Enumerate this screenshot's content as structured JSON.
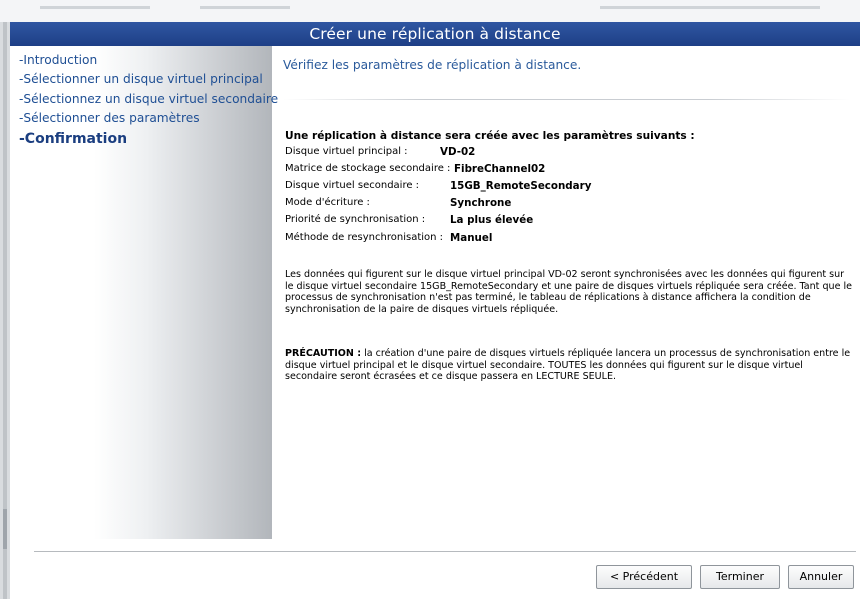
{
  "window": {
    "title": "Créer une réplication à distance"
  },
  "sidebar": {
    "items": [
      {
        "label": "-Introduction",
        "active": false
      },
      {
        "label": "-Sélectionner un disque virtuel principal",
        "active": false
      },
      {
        "label": "-Sélectionnez un disque virtuel secondaire",
        "active": false
      },
      {
        "label": "-Sélectionner des paramètres",
        "active": false
      },
      {
        "label": "-Confirmation",
        "active": true
      }
    ]
  },
  "content": {
    "instruction": "Vérifiez les paramètres de réplication à distance.",
    "heading": "Une réplication à distance sera créée avec les paramètres suivants :",
    "params": [
      {
        "label": "Disque virtuel principal :",
        "value": "VD-02"
      },
      {
        "label": "Matrice de stockage secondaire :",
        "value": "FibreChannel02"
      },
      {
        "label": "Disque virtuel secondaire :",
        "value": "15GB_RemoteSecondary"
      },
      {
        "label": "Mode d'écriture :",
        "value": "Synchrone"
      },
      {
        "label": "Priorité de synchronisation :",
        "value": "La plus élevée"
      },
      {
        "label": "Méthode de resynchronisation :",
        "value": "Manuel"
      }
    ],
    "info_paragraph": "Les données qui figurent sur le disque virtuel principal VD-02 seront synchronisées avec les données qui figurent sur le disque virtuel secondaire 15GB_RemoteSecondary et une paire de disques virtuels répliquée sera créée. Tant que le processus de synchronisation n'est pas terminé, le tableau de réplications à distance affichera la condition de synchronisation de la paire de disques virtuels répliquée.",
    "caution_label": "PRÉCAUTION :",
    "caution_text": " la création d'une paire de disques virtuels répliquée lancera un processus de synchronisation entre le disque virtuel principal et le disque virtuel secondaire. TOUTES les données qui figurent sur le disque virtuel secondaire seront écrasées et ce disque passera en LECTURE SEULE."
  },
  "footer": {
    "previous_label": "< Précédent",
    "finish_label": "Terminer",
    "cancel_label": "Annuler"
  }
}
